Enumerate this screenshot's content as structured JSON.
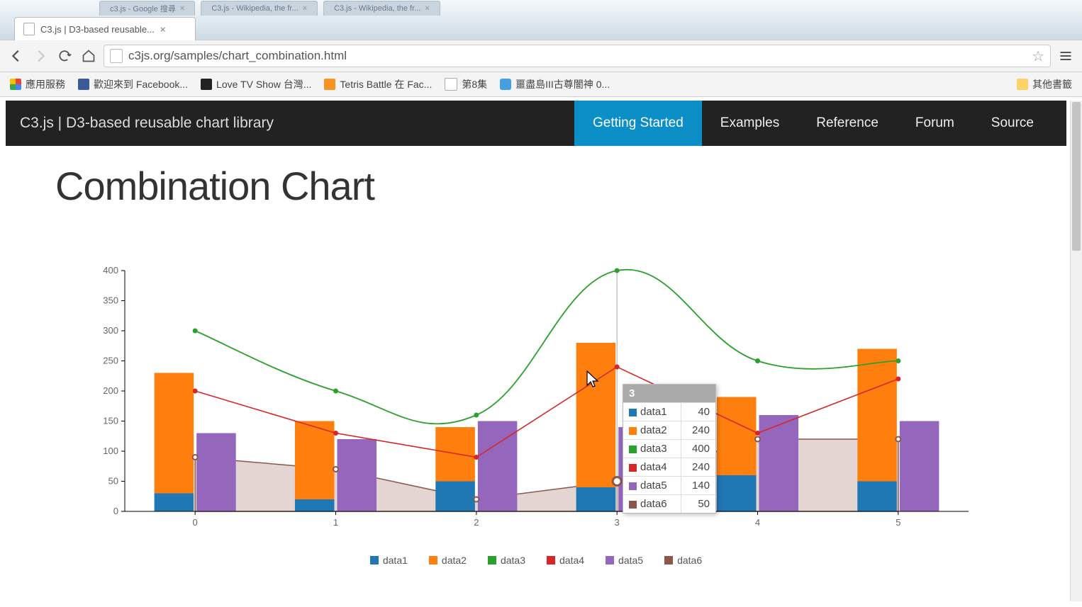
{
  "window": {
    "bg_tabs": [
      "c3.js - Google 搜尋",
      "C3.js - Wikipedia, the fr...",
      "C3.js - Wikipedia, the fr..."
    ],
    "active_tab": "C3.js | D3-based reusable...",
    "url": "c3js.org/samples/chart_combination.html"
  },
  "bookmarks": {
    "apps": "應用服務",
    "items": [
      "歡迎來到 Facebook...",
      "Love TV Show 台灣...",
      "Tetris Battle 在 Fac...",
      "第8集",
      "噩盡島III古尊闇神 0..."
    ],
    "other": "其他書籤"
  },
  "site": {
    "brand": "C3.js | D3-based reusable chart library",
    "nav": {
      "cta": "Getting Started",
      "links": [
        "Examples",
        "Reference",
        "Forum",
        "Source"
      ]
    }
  },
  "page": {
    "title": "Combination Chart"
  },
  "chart_data": {
    "type": "combination",
    "categories": [
      "0",
      "1",
      "2",
      "3",
      "4",
      "5"
    ],
    "ylim": [
      0,
      400
    ],
    "yticks": [
      0,
      50,
      100,
      150,
      200,
      250,
      300,
      350,
      400
    ],
    "series": [
      {
        "name": "data1",
        "type": "bar",
        "stack": "A",
        "color": "#1f77b4",
        "values": [
          30,
          20,
          50,
          40,
          60,
          50
        ]
      },
      {
        "name": "data2",
        "type": "bar",
        "stack": "A",
        "color": "#ff7f0e",
        "values": [
          200,
          130,
          90,
          240,
          130,
          220
        ]
      },
      {
        "name": "data3",
        "type": "spline",
        "color": "#2ca02c",
        "values": [
          300,
          200,
          160,
          400,
          250,
          250
        ]
      },
      {
        "name": "data4",
        "type": "line",
        "color": "#d62728",
        "values": [
          200,
          130,
          90,
          240,
          130,
          220
        ]
      },
      {
        "name": "data5",
        "type": "bar",
        "color": "#9467bd",
        "values": [
          130,
          120,
          150,
          140,
          160,
          150
        ]
      },
      {
        "name": "data6",
        "type": "area",
        "color": "#8c564b",
        "values": [
          90,
          70,
          20,
          50,
          120,
          120
        ]
      }
    ],
    "legend": [
      "data1",
      "data2",
      "data3",
      "data4",
      "data5",
      "data6"
    ],
    "tooltip": {
      "x_label": "3",
      "rows": [
        {
          "name": "data1",
          "value": 40,
          "color": "#1f77b4"
        },
        {
          "name": "data2",
          "value": 240,
          "color": "#ff7f0e"
        },
        {
          "name": "data3",
          "value": 400,
          "color": "#2ca02c"
        },
        {
          "name": "data4",
          "value": 240,
          "color": "#d62728"
        },
        {
          "name": "data5",
          "value": 140,
          "color": "#9467bd"
        },
        {
          "name": "data6",
          "value": 50,
          "color": "#8c564b"
        }
      ]
    }
  }
}
